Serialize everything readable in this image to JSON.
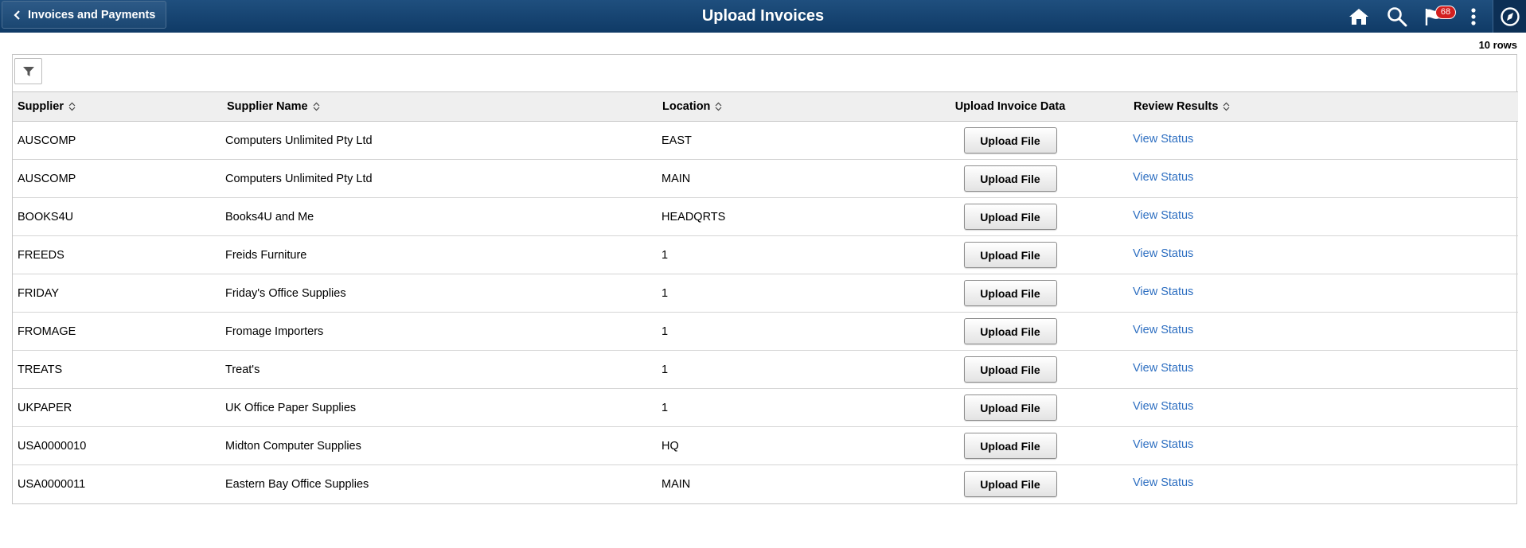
{
  "header": {
    "back_label": "Invoices and Payments",
    "title": "Upload Invoices",
    "notification_count": "68"
  },
  "grid": {
    "row_count": "10 rows",
    "columns": {
      "supplier": "Supplier",
      "supplier_name": "Supplier Name",
      "location": "Location",
      "upload": "Upload Invoice Data",
      "review": "Review Results"
    },
    "rows": [
      {
        "supplier": "AUSCOMP",
        "name": "Computers Unlimited Pty Ltd",
        "location": "EAST",
        "button": "Upload File",
        "link": "View Status"
      },
      {
        "supplier": "AUSCOMP",
        "name": "Computers Unlimited Pty Ltd",
        "location": "MAIN",
        "button": "Upload File",
        "link": "View Status"
      },
      {
        "supplier": "BOOKS4U",
        "name": "Books4U and Me",
        "location": "HEADQRTS",
        "button": "Upload File",
        "link": "View Status"
      },
      {
        "supplier": "FREEDS",
        "name": "Freids Furniture",
        "location": "1",
        "button": "Upload File",
        "link": "View Status"
      },
      {
        "supplier": "FRIDAY",
        "name": "Friday's Office Supplies",
        "location": "1",
        "button": "Upload File",
        "link": "View Status"
      },
      {
        "supplier": "FROMAGE",
        "name": "Fromage Importers",
        "location": "1",
        "button": "Upload File",
        "link": "View Status"
      },
      {
        "supplier": "TREATS",
        "name": "Treat's",
        "location": "1",
        "button": "Upload File",
        "link": "View Status"
      },
      {
        "supplier": "UKPAPER",
        "name": "UK Office Paper Supplies",
        "location": "1",
        "button": "Upload File",
        "link": "View Status"
      },
      {
        "supplier": "USA0000010",
        "name": "Midton Computer Supplies",
        "location": "HQ",
        "button": "Upload File",
        "link": "View Status"
      },
      {
        "supplier": "USA0000011",
        "name": "Eastern Bay Office Supplies",
        "location": "MAIN",
        "button": "Upload File",
        "link": "View Status"
      }
    ]
  },
  "icons": {
    "back": "chevron-left-icon",
    "home": "home-icon",
    "search": "search-icon",
    "notifications": "flag-icon",
    "actions": "more-vertical-icon",
    "navbar": "compass-icon",
    "filter": "filter-icon",
    "sort": "sort-icon"
  },
  "colors": {
    "header_bg": "#1a4876",
    "link": "#2e6fc1",
    "badge": "#d31f1f",
    "column_header_bg": "#efefef"
  }
}
